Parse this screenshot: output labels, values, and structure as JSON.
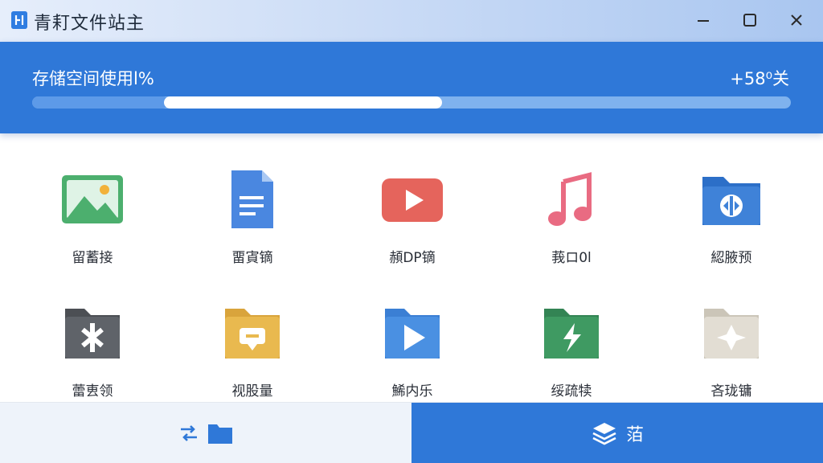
{
  "window": {
    "title": "青耓文件站主",
    "icon": "app-logo-icon"
  },
  "window_controls": {
    "minimize_icon": "minimize-icon",
    "maximize_icon": "maximize-icon",
    "close_icon": "close-icon"
  },
  "storage": {
    "label": "存储空间使用l%",
    "amount": "+58⁰关",
    "used_fraction": 0.18,
    "pending_fraction": 0.54
  },
  "categories": [
    {
      "label": "留蓄接",
      "icon": "image-icon",
      "color": "#4caf6e"
    },
    {
      "label": "畱寊镝",
      "icon": "document-icon",
      "color": "#4a87e0"
    },
    {
      "label": "頳DP镝",
      "icon": "video-icon",
      "color": "#e5645c"
    },
    {
      "label": "莪ロ0l",
      "icon": "music-icon",
      "color": "#e96b82"
    },
    {
      "label": "綛腋预",
      "icon": "archive-folder-icon",
      "color": "#3f82d8"
    },
    {
      "label": "蕾叀领",
      "icon": "app-folder-icon",
      "color": "#5f6369"
    },
    {
      "label": "视股量",
      "icon": "chat-folder-icon",
      "color": "#e9b94f"
    },
    {
      "label": "鯑内乐",
      "icon": "play-folder-icon",
      "color": "#4a90e2"
    },
    {
      "label": "绥疏犊",
      "icon": "split-folder-icon",
      "color": "#3f9a62"
    },
    {
      "label": "吝珑镛",
      "icon": "star-folder-icon",
      "color": "#d9d4c9"
    }
  ],
  "bottom": {
    "transfer_icon": "transfer-icon",
    "folder_icon": "folder-icon",
    "primary_icon": "layers-icon",
    "primary_label": "萡"
  },
  "colors": {
    "accent": "#2f78d8",
    "progress_track": "#7fb2ee",
    "progress_fill": "#ffffff"
  }
}
